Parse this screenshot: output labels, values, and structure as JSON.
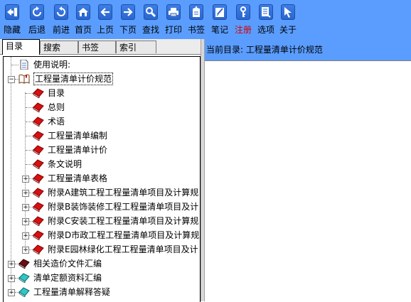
{
  "toolbar": {
    "buttons": [
      {
        "name": "hide",
        "label": "隐藏",
        "icon": "hide-panel-icon"
      },
      {
        "name": "back",
        "label": "后退",
        "icon": "back-circle-icon"
      },
      {
        "name": "forward",
        "label": "前进",
        "icon": "forward-circle-icon"
      },
      {
        "name": "home",
        "label": "首页",
        "icon": "home-icon"
      },
      {
        "name": "prev",
        "label": "上页",
        "icon": "arrow-left-icon"
      },
      {
        "name": "next",
        "label": "下页",
        "icon": "arrow-right-icon"
      },
      {
        "name": "find",
        "label": "查找",
        "icon": "magnifier-icon"
      },
      {
        "name": "print",
        "label": "打印",
        "icon": "printer-icon"
      },
      {
        "name": "bookmark",
        "label": "书签",
        "icon": "bookmark-icon"
      },
      {
        "name": "notes",
        "label": "笔记",
        "icon": "notes-icon"
      },
      {
        "name": "register",
        "label": "注册",
        "icon": "key-icon"
      },
      {
        "name": "options",
        "label": "选项",
        "icon": "options-icon"
      },
      {
        "name": "about",
        "label": "关于",
        "icon": "cursor-icon"
      }
    ]
  },
  "tabs": [
    "目录",
    "搜索",
    "书签",
    "索引"
  ],
  "tree": [
    {
      "label": "使用说明:",
      "icon": "document-icon"
    },
    {
      "label": "工程量清单计价规范",
      "icon": "open-book-icon"
    },
    {
      "label": "目录",
      "icon": "red-book-icon"
    },
    {
      "label": "总则",
      "icon": "red-book-icon"
    },
    {
      "label": "术语",
      "icon": "red-book-icon"
    },
    {
      "label": "工程量清单编制",
      "icon": "red-book-icon"
    },
    {
      "label": "工程量清单计价",
      "icon": "red-book-icon"
    },
    {
      "label": "条文说明",
      "icon": "red-book-icon"
    },
    {
      "label": "工程量清单表格",
      "icon": "red-book-icon"
    },
    {
      "label": "附录A建筑工程工程量清单项目及计算规",
      "icon": "red-book-icon"
    },
    {
      "label": "附录B装饰装修工程工程量清单项目及计",
      "icon": "red-book-icon"
    },
    {
      "label": "附录C安装工程工程量清单项目及计算规",
      "icon": "red-book-icon"
    },
    {
      "label": "附录D市政工程工程量清单项目及计算规",
      "icon": "red-book-icon"
    },
    {
      "label": "附录E园林绿化工程工程量清单项目及计",
      "icon": "red-book-icon"
    },
    {
      "label": "相关造价文件汇编",
      "icon": "dark-book-icon"
    },
    {
      "label": "清单定额资料汇编",
      "icon": "cyan-book-icon"
    },
    {
      "label": "工程量清单解释答疑",
      "icon": "cyan-book-icon"
    }
  ],
  "path": {
    "prefix": "当前目录:",
    "value": "工程量清单计价规范"
  },
  "colors": {
    "toolbar_bg": "#5a9dff",
    "register_label": "#d40000",
    "red_book": "#d81010",
    "cyan_book": "#2ec6c6"
  }
}
